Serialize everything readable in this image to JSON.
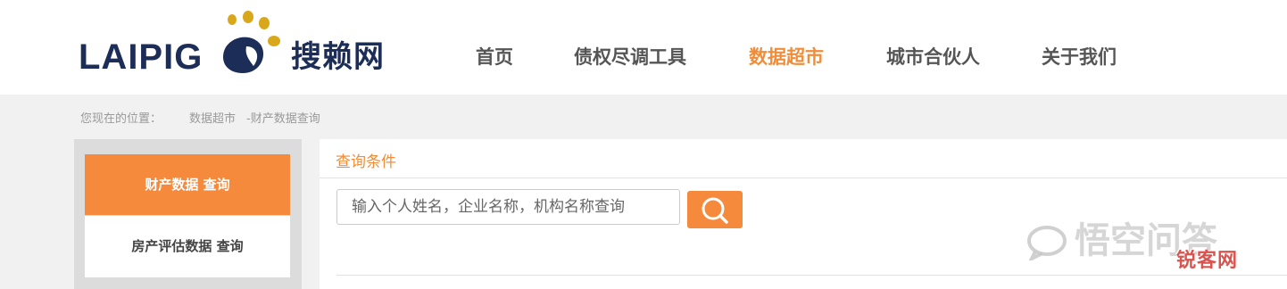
{
  "brand": {
    "name_en": "LAIPIG",
    "name_cn": "搜赖网",
    "colors": {
      "navy": "#1c2d57",
      "gold": "#d9a81a",
      "accent": "#f08d3a"
    }
  },
  "nav": {
    "items": [
      {
        "label": "首页",
        "active": false
      },
      {
        "label": "债权尽调工具",
        "active": false
      },
      {
        "label": "数据超市",
        "active": true
      },
      {
        "label": "城市合伙人",
        "active": false
      },
      {
        "label": "关于我们",
        "active": false
      }
    ]
  },
  "breadcrumb": {
    "prefix": "您现在的位置：",
    "items": [
      "数据超市",
      "财产数据查询"
    ],
    "separator": "-"
  },
  "sidebar": {
    "items": [
      {
        "label": "财产数据 查询",
        "active": true
      },
      {
        "label": "房产评估数据 查询",
        "active": false
      }
    ]
  },
  "main": {
    "section_title": "查询条件",
    "search": {
      "placeholder": "输入个人姓名，企业名称，机构名称查询",
      "value": "",
      "button_icon": "search-icon"
    }
  },
  "watermarks": {
    "wukong": "悟空问答",
    "ruike": "锐客网"
  }
}
